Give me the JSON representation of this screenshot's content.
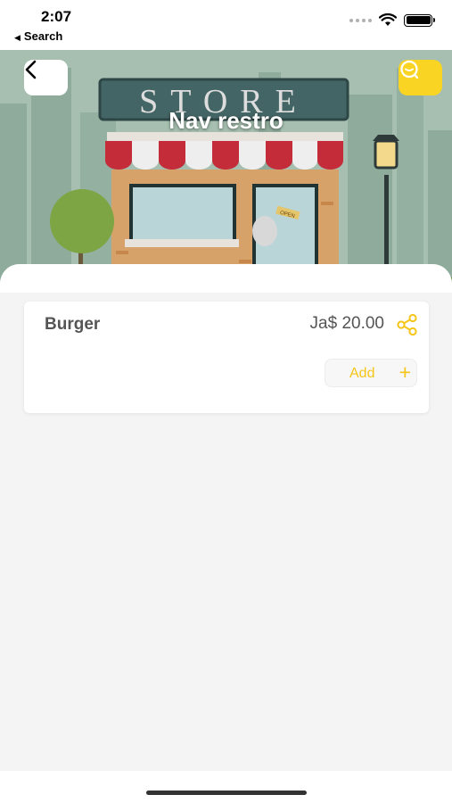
{
  "status_bar": {
    "time": "2:07",
    "back_label": "Search"
  },
  "header": {
    "store_name": "Nav restro",
    "sign_text": "STORE",
    "door_sign": "OPEN"
  },
  "items": [
    {
      "name": "Burger",
      "price": "Ja$ 20.00",
      "add_label": "Add",
      "add_symbol": "+"
    }
  ],
  "colors": {
    "accent": "#f5c518",
    "chat_button": "#f9d423"
  }
}
